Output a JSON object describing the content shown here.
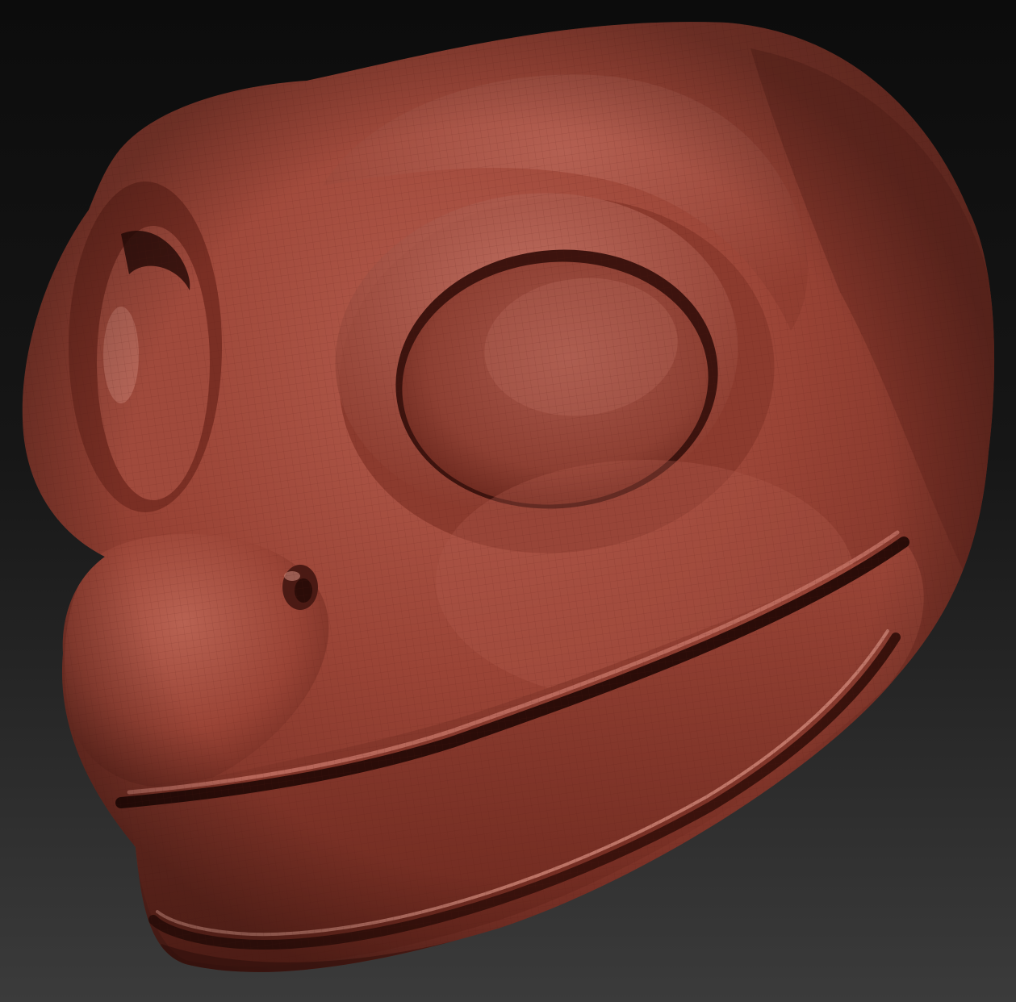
{
  "scene": {
    "background_top": "#0c0c0c",
    "background_bottom": "#3b3b3b",
    "material": {
      "base": "#9a4436",
      "highlight": "#c97a6c",
      "shadow": "#4a1a14",
      "deep_shadow": "#2a0c08"
    },
    "model_name": "lizard-head-sculpt",
    "wireframe_visible": true
  }
}
